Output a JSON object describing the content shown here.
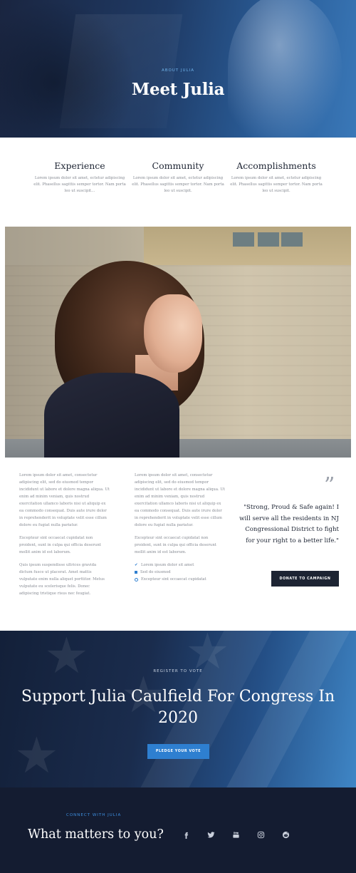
{
  "hero": {
    "eyebrow": "ABOUT JULIA",
    "title": "Meet Julia"
  },
  "features": [
    {
      "title": "Experience",
      "text": "Lorem ipsum dolor sit amet, ectetur adipiscing elit. Phasellus sagittis semper tortor. Nam porta leo ut suscipit…"
    },
    {
      "title": "Community",
      "text": "Lorem ipsum dolor sit amet, ectetur adipiscing elit. Phasellus sagittis semper tortor. Nam porta leo ut suscipit."
    },
    {
      "title": "Accomplishments",
      "text": "Lorem ipsum dolor sit amet, ectetur adipiscing elit. Phasellus sagittis semper tortor. Nam porta leo ut suscipit."
    }
  ],
  "content": {
    "col1": [
      "Lorem ipsum dolor sit amet, consectetur adipiscing elit, sed do eiusmod tempor incididunt ut labore et dolore magna aliqua. Ut enim ad minim veniam, quis nostrud exercitation ullamco laboris nisi ut aliquip ex ea commodo consequat. Duis aute irure dolor in reprehenderit in voluptate velit esse cillum dolore eu fugiat nulla pariatur.",
      "Excepteur sint occaecat cupidatat non proident, sunt in culpa qui officia deserunt mollit anim id est laborum.",
      "Quis ipsum suspendisse ultrices gravida dictum fusce ut placerat. Amet mattis vulputate enim nulla aliquet porttitor. Metus vulputate eu scelerisque felis. Donec adipiscing tristique risus nec feugiat."
    ],
    "col2": [
      "Lorem ipsum dolor sit amet, consectetur adipiscing elit, sed do eiusmod tempor incididunt ut labore et dolore magna aliqua. Ut enim ad minim veniam, quis nostrud exercitation ullamco laboris nisi ut aliquip ex ea commodo consequat. Duis aute irure dolor in reprehenderit in voluptate velit esse cillum dolore eu fugiat nulla pariatur.",
      "Excepteur sint occaecat cupidatat non proident, sunt in culpa qui officia deserunt mollit anim id est laborum."
    ],
    "list": [
      {
        "icon": "check-icon",
        "text": "Lorem ipsum dolor sit amet"
      },
      {
        "icon": "square-icon",
        "text": "Sed do eiusmod"
      },
      {
        "icon": "circle-check-icon",
        "text": "Excepteur sint occaecat cupidatat"
      }
    ],
    "quote_mark": "”",
    "quote": "\"Strong, Proud & Safe again! I will serve all the residents in NJ Congressional District to fight for your right to a better life.\"",
    "donate_button": "DONATE TO CAMPAIGN"
  },
  "cta": {
    "eyebrow": "REGISTER TO VOTE",
    "title": "Support Julia Caulfield For Congress In 2020",
    "button": "PLEDGE YOUR VOTE"
  },
  "footer": {
    "eyebrow": "CONNECT WITH JULIA",
    "title": "What matters to you?",
    "socials": [
      "facebook-icon",
      "twitter-icon",
      "youtube-icon",
      "instagram-icon",
      "reddit-icon"
    ]
  },
  "colors": {
    "accent": "#2e7fd0",
    "navy": "#1d2433",
    "footer_bg": "#141c31"
  }
}
